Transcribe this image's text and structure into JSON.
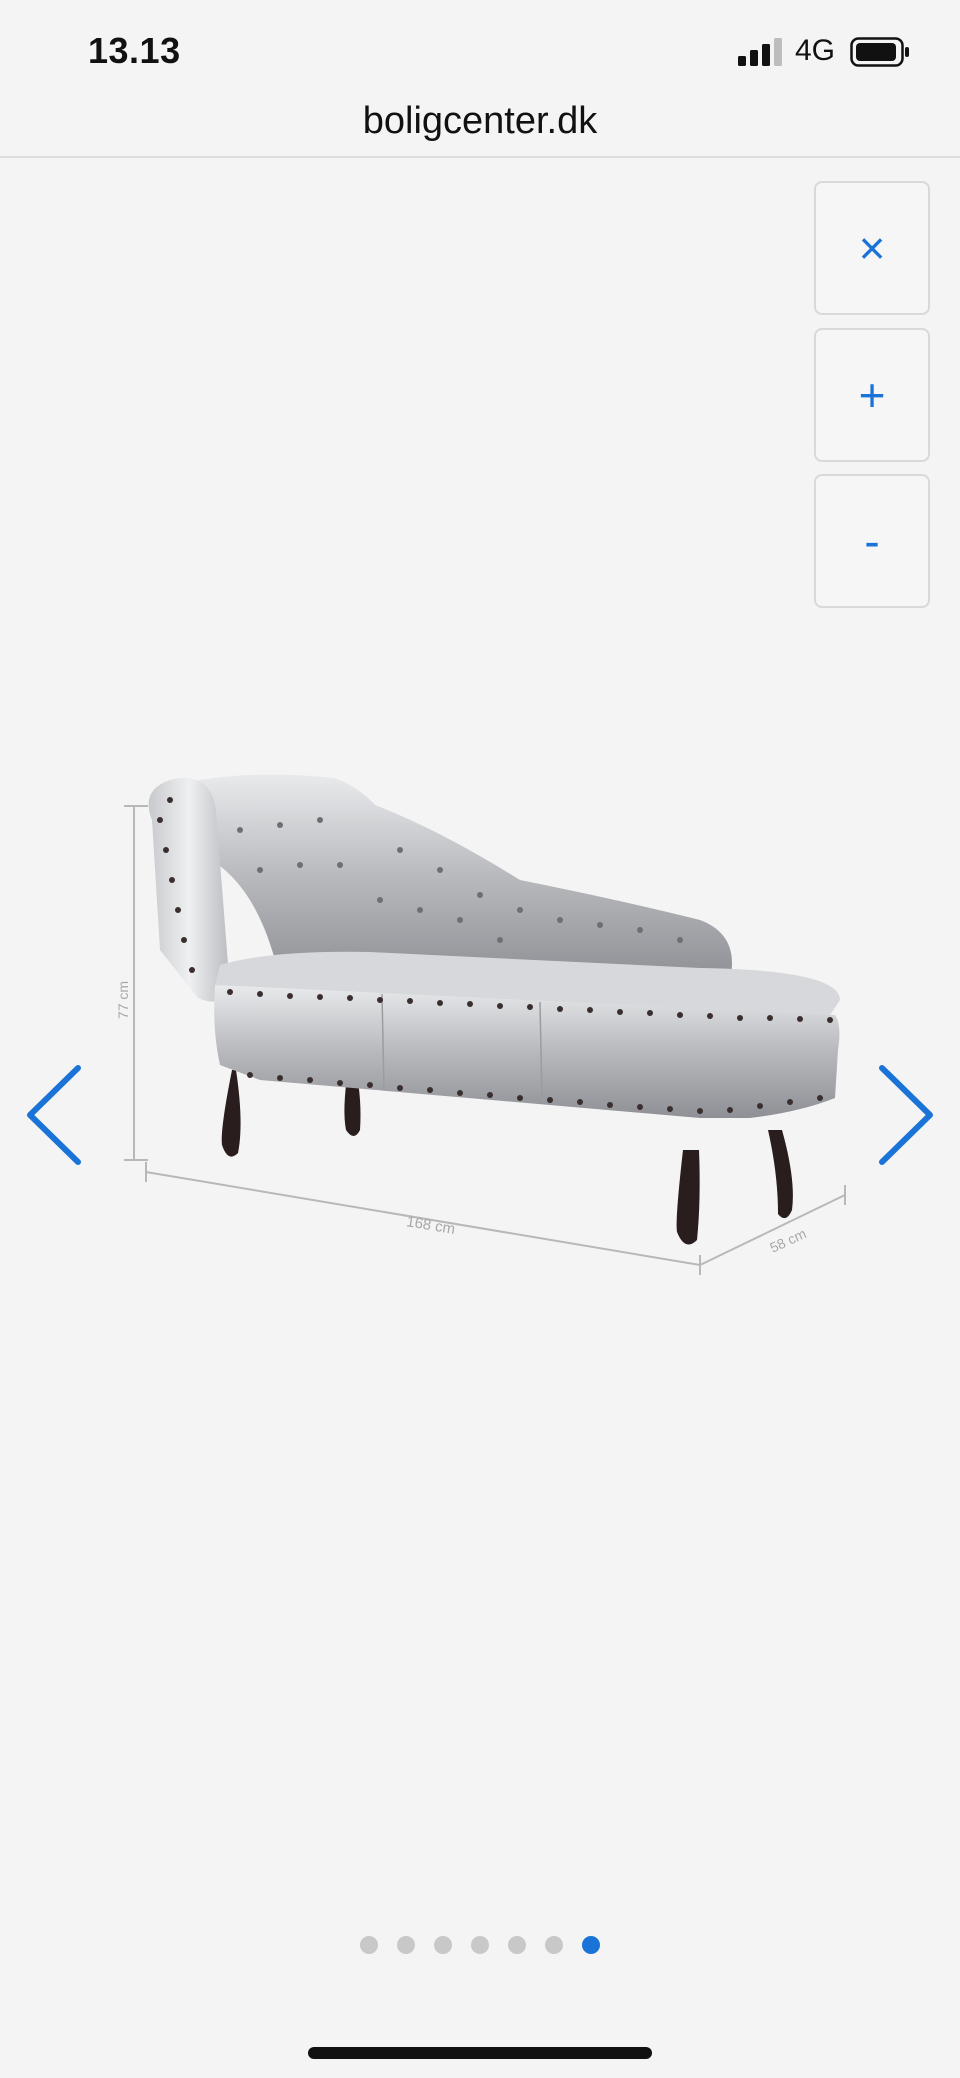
{
  "status_bar": {
    "time": "13.13",
    "network": "4G",
    "icons": [
      "signal-icon",
      "battery-icon"
    ]
  },
  "browser": {
    "url": "boligcenter.dk"
  },
  "gallery": {
    "controls": {
      "close_label": "×",
      "zoom_in_label": "+",
      "zoom_out_label": "-"
    },
    "nav_icons": [
      "chevron-left-icon",
      "chevron-right-icon"
    ],
    "image": {
      "dimension_height": "77 cm",
      "dimension_length": "168 cm",
      "dimension_depth": "58 cm"
    },
    "pagination": {
      "total": 7,
      "active_index": 6
    }
  },
  "colors": {
    "accent": "#1a73d6",
    "inactive_dot": "#c8c8c8"
  }
}
